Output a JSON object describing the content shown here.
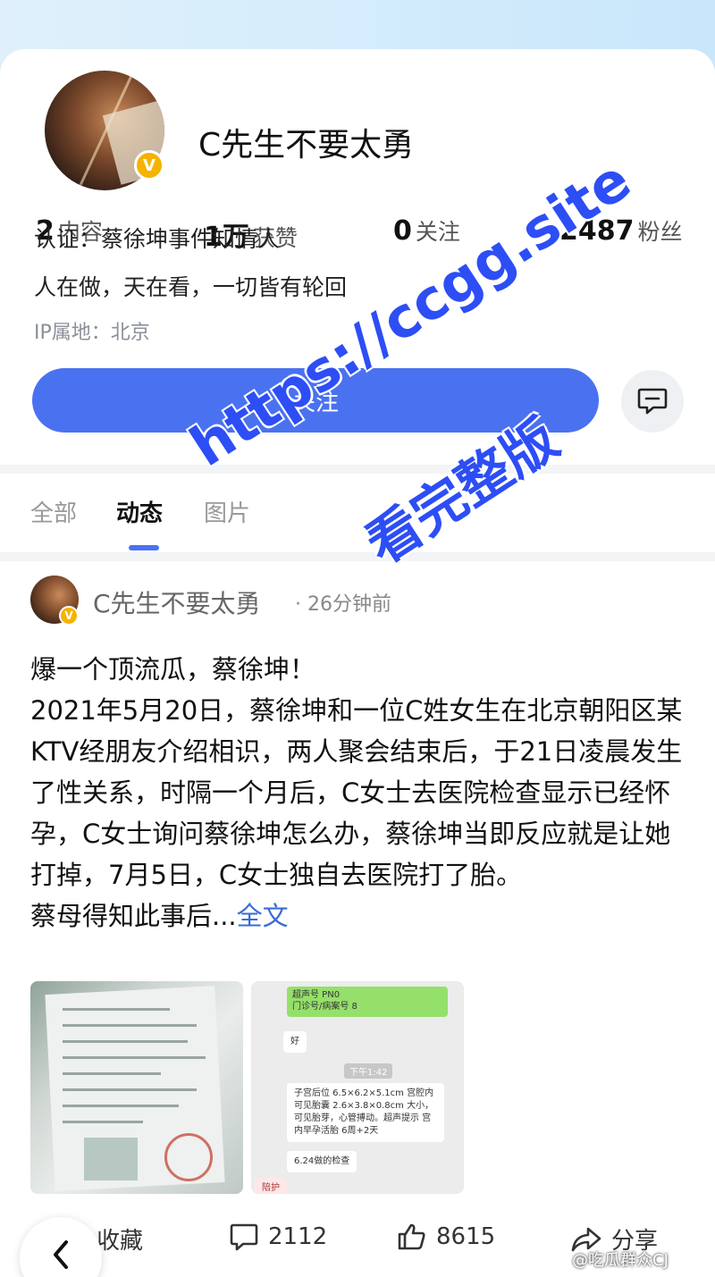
{
  "profile": {
    "name": "C先生不要太勇",
    "verified_icon": "v-badge-icon",
    "stats": [
      {
        "num": "2",
        "label": "内容"
      },
      {
        "num": "1万",
        "label": "获赞"
      },
      {
        "num": "0",
        "label": "关注"
      },
      {
        "num": "2487",
        "label": "粉丝"
      }
    ],
    "certification": "认证：蔡徐坤事件知情人",
    "motto": "人在做，天在看，一切皆有轮回",
    "ip": "IP属地：北京",
    "follow_label": "关注",
    "message_icon": "chat-bubble-icon"
  },
  "tabs": [
    {
      "label": "全部"
    },
    {
      "label": "动态"
    },
    {
      "label": "图片"
    }
  ],
  "post": {
    "author": "C先生不要太勇",
    "time": "· 26分钟前",
    "title": "爆一个顶流瓜，蔡徐坤！",
    "body": "2021年5月20日，蔡徐坤和一位C姓女生在北京朝阳区某KTV经朋友介绍相识，两人聚会结束后，于21日凌晨发生了性关系，时隔一个月后，C女士去医院检查显示已经怀孕，C女士询问蔡徐坤怎么办，蔡徐坤当即反应就是让她打掉，7月5日，C女士独自去医院打了胎。",
    "last_line": "蔡母得知此事后...",
    "more": "全文",
    "image2": {
      "header_line1": "超声号 PN0",
      "header_line2": "门诊号/病案号 8",
      "reply": "好",
      "time": "下午1:42",
      "report": "子宫后位 6.5×6.2×5.1cm 宫腔内可见胎囊 2.6×3.8×0.8cm 大小，可见胎芽，心管搏动。超声提示 宫内早孕活胎 6周+2天",
      "note": "6.24做的检查",
      "footer": "陪护"
    },
    "actions": {
      "favorite": "收藏",
      "comments": "2112",
      "likes": "8615",
      "share": "分享"
    }
  },
  "watermark": {
    "url": "https://ccgg.site",
    "text": "看完整版",
    "source": "@吃瓜群众CJ"
  },
  "colors": {
    "accent": "#4a72f0",
    "badge": "#f5b300",
    "link": "#3a6bd6",
    "watermark": "#2d4ef5"
  }
}
